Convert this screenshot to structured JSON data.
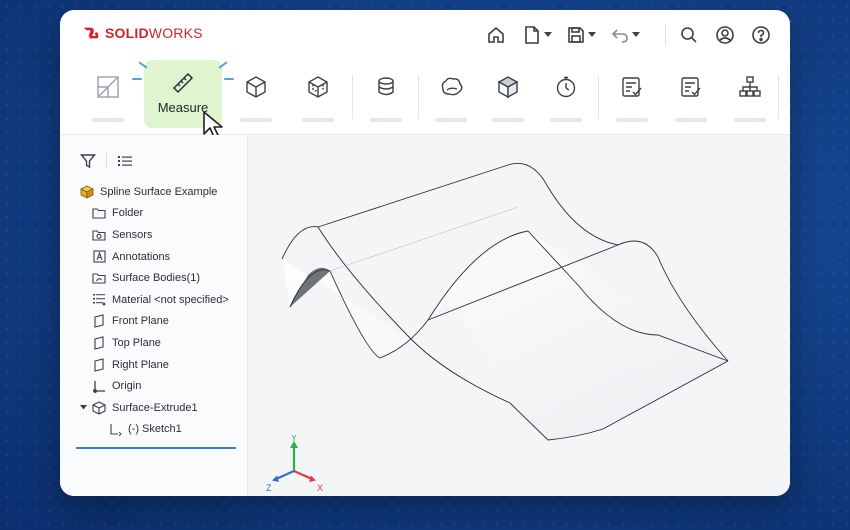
{
  "app": {
    "brand_prefix": "SOLID",
    "brand_suffix": "WORKS"
  },
  "titlebar_icons": [
    "home-icon",
    "new-document-icon",
    "save-icon",
    "undo-icon",
    "search-icon",
    "user-icon",
    "help-icon"
  ],
  "ribbon": {
    "measure_label": "Measure",
    "tools": [
      "sketch-icon",
      "measure-icon",
      "box-3d-icon",
      "cube-wire-icon",
      "cylinder-icon",
      "blob-shape-icon",
      "solid-cube-icon",
      "stopwatch-icon",
      "checklist-icon",
      "checklist-icon",
      "hierarchy-icon"
    ]
  },
  "tree": {
    "root": "Spline Surface Example",
    "items": [
      {
        "label": "Folder",
        "icon": "folder-icon"
      },
      {
        "label": "Sensors",
        "icon": "sensor-icon"
      },
      {
        "label": "Annotations",
        "icon": "annotation-icon"
      },
      {
        "label": "Surface Bodies(1)",
        "icon": "surface-bodies-icon"
      },
      {
        "label": "Material <not specified>",
        "icon": "material-icon"
      },
      {
        "label": "Front Plane",
        "icon": "plane-icon"
      },
      {
        "label": "Top Plane",
        "icon": "plane-icon"
      },
      {
        "label": "Right Plane",
        "icon": "plane-icon"
      },
      {
        "label": "Origin",
        "icon": "origin-icon"
      },
      {
        "label": "Surface-Extrude1",
        "icon": "feature-icon"
      },
      {
        "label": "(-) Sketch1",
        "icon": "sketch-icon"
      }
    ]
  },
  "triad": {
    "x": "X",
    "y": "Y",
    "z": "Z"
  },
  "colors": {
    "brand_red": "#d0242b",
    "measure_bg": "#def5cf",
    "accent_blue": "#2f7fd0"
  }
}
